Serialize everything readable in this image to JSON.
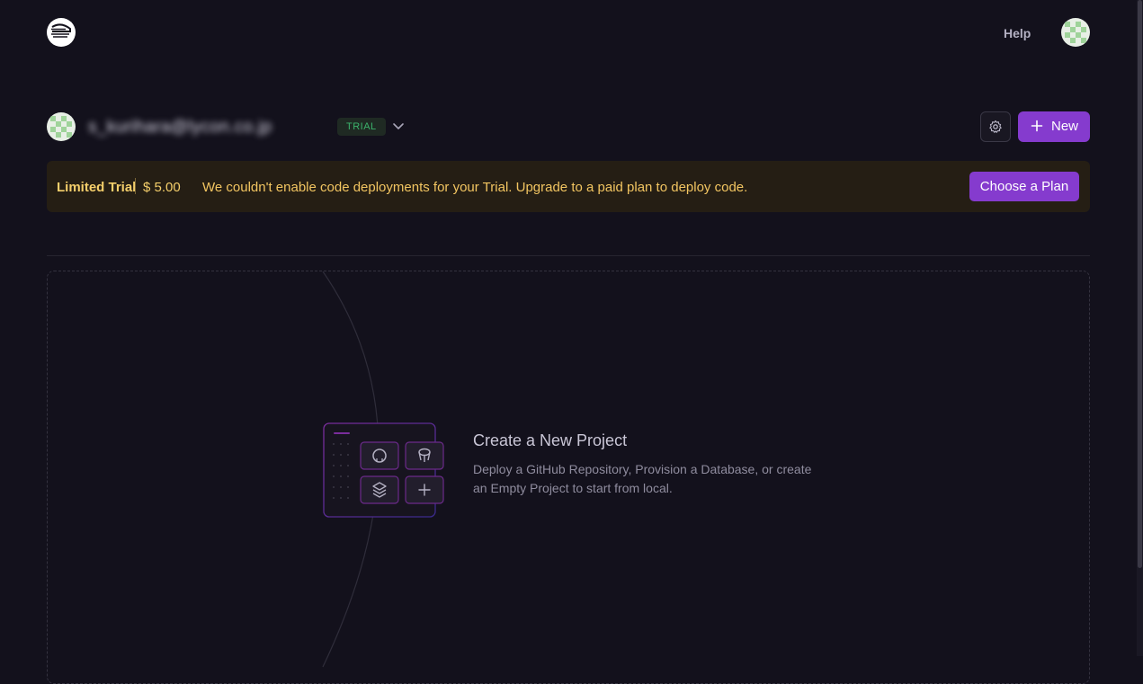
{
  "header": {
    "help_label": "Help"
  },
  "team": {
    "name": "s_kurihara@lycon.co.jp",
    "plan_badge": "TRIAL",
    "new_button_label": "New"
  },
  "trial_banner": {
    "title": "Limited Trial",
    "credit": "$ 5.00",
    "message": "We couldn't enable code deployments for your Trial. Upgrade to a paid plan to deploy code.",
    "button_label": "Choose a Plan"
  },
  "empty_state": {
    "title": "Create a New Project",
    "description": "Deploy a GitHub Repository, Provision a Database, or create an Empty Project to start from local."
  },
  "colors": {
    "background": "#13111c",
    "accent": "#853bce",
    "banner_bg": "#251e14",
    "banner_text": "#f5cf6b",
    "trial_badge": "#3bb36b"
  },
  "icons": [
    "logo-icon",
    "user-avatar",
    "chevron-down-icon",
    "gear-icon",
    "plus-icon",
    "github-icon",
    "database-icon",
    "stack-icon"
  ]
}
